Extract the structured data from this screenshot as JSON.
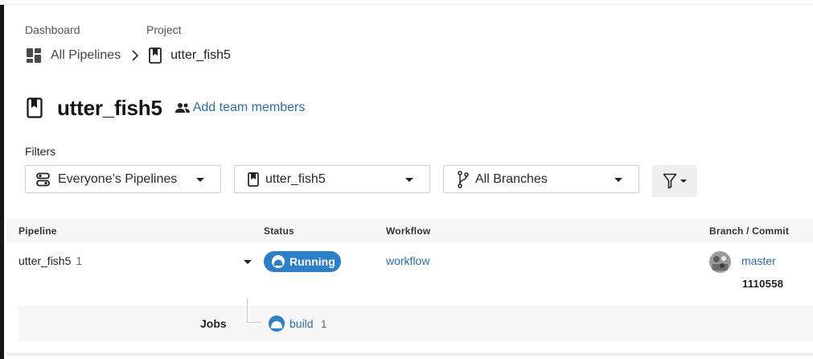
{
  "breadcrumb": {
    "dashboard_label": "Dashboard",
    "project_label": "Project",
    "all_pipelines": "All Pipelines",
    "project_name": "utter_fish5"
  },
  "header": {
    "title": "utter_fish5",
    "add_team_members": "Add team members"
  },
  "filters": {
    "label": "Filters",
    "pipelines_filter": "Everyone’s Pipelines",
    "project_filter": "utter_fish5",
    "branch_filter": "All Branches"
  },
  "table": {
    "headers": {
      "pipeline": "Pipeline",
      "status": "Status",
      "workflow": "Workflow",
      "branch_commit": "Branch / Commit"
    },
    "rows": [
      {
        "pipeline_name": "utter_fish5",
        "pipeline_number": "1",
        "status": "Running",
        "workflow": "workflow",
        "branch": "master",
        "commit": "1110558",
        "jobs_label": "Jobs",
        "jobs": [
          {
            "name": "build",
            "number": "1"
          }
        ]
      }
    ]
  },
  "colors": {
    "accent_link": "#2d6ea8",
    "status_running": "#2d7fc6",
    "header_bg": "#f7f7f7"
  },
  "icons": {
    "dashboard": "dashboard-grid-icon",
    "project": "bookmark-icon",
    "team": "people-icon",
    "pipelines_filter": "pipelines-icon",
    "branch": "git-branch-icon",
    "filter": "funnel-icon",
    "status": "running-icon"
  }
}
